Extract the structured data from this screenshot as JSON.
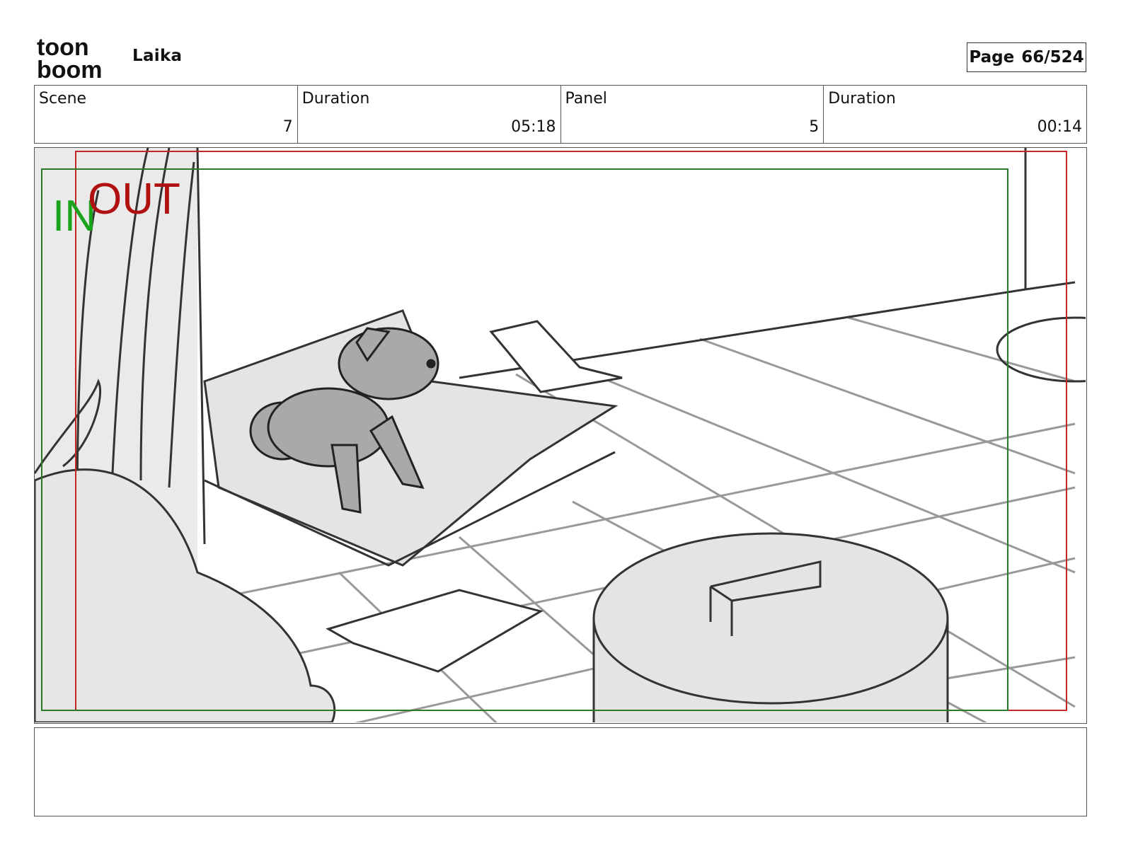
{
  "header": {
    "logo_text_top": "toon",
    "logo_text_bottom": "boom",
    "project_title": "Laika",
    "page_label": "Page",
    "page_number": "66/524"
  },
  "info": {
    "scene_label": "Scene",
    "scene_value": "7",
    "scene_duration_label": "Duration",
    "scene_duration_value": "05:18",
    "panel_label": "Panel",
    "panel_value": "5",
    "panel_duration_label": "Duration",
    "panel_duration_value": "00:14"
  },
  "panel": {
    "in_marker": "IN",
    "out_marker": "OUT",
    "in_color": "#1aa31a",
    "out_color": "#b01010",
    "image_description_icon": "storyboard-sketch"
  },
  "notes": {
    "text": ""
  }
}
